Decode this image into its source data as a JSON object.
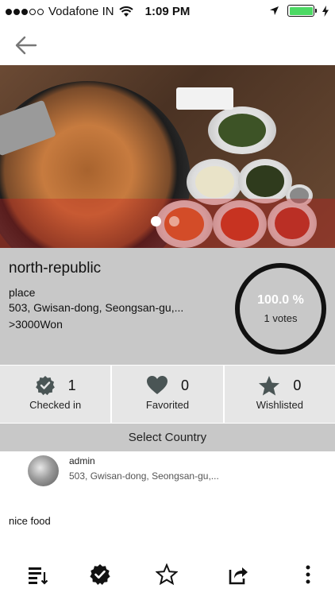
{
  "status_bar": {
    "carrier": "Vodafone IN",
    "time": "1:09 PM",
    "signal_dots_filled": 3,
    "signal_dots_total": 5,
    "battery_level": 1.0
  },
  "nav": {
    "back_icon": "arrow-left-icon"
  },
  "hero": {
    "image_description_icon": "food-photo",
    "pager_total": 2,
    "pager_active": 1
  },
  "place": {
    "name": "north-republic",
    "type": "place",
    "address": "503, Gwisan-dong, Seongsan-gu,...",
    "price": ">3000Won"
  },
  "rating": {
    "percent": "100.0 %",
    "votes": "1 votes"
  },
  "stats": [
    {
      "icon": "check-badge-icon",
      "count": "1",
      "label": "Checked in"
    },
    {
      "icon": "heart-icon",
      "count": "0",
      "label": "Favorited"
    },
    {
      "icon": "star-icon",
      "count": "0",
      "label": "Wishlisted"
    }
  ],
  "select_country": "Select Country",
  "comment": {
    "user": "admin",
    "address": "503, Gwisan-dong, Seongsan-gu,...",
    "text": "nice food"
  },
  "toolbar": {
    "items": [
      "sort-list-icon",
      "check-badge-icon",
      "star-outline-icon",
      "share-icon",
      "more-vertical-icon"
    ]
  },
  "colors": {
    "info_bg": "#c8c8c8",
    "stats_bg": "#e6e6e6",
    "icon_gray": "#4a5555",
    "battery_green": "#4cd964"
  }
}
